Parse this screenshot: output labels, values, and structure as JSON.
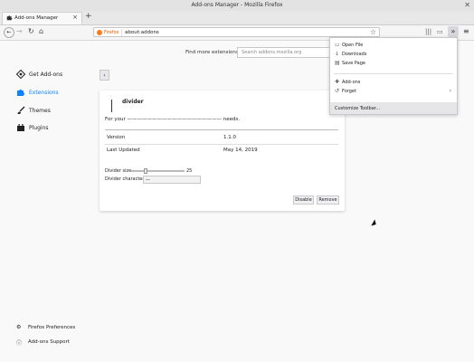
{
  "window": {
    "title": "Add-ons Manager - Mozilla Firefox"
  },
  "tab": {
    "label": "Add-ons Manager"
  },
  "urlbar": {
    "brand": "Firefox",
    "url": "about:addons"
  },
  "sidebar": {
    "items": [
      {
        "label": "Get Add-ons",
        "icon": "get-addons-icon"
      },
      {
        "label": "Extensions",
        "icon": "puzzle-icon"
      },
      {
        "label": "Themes",
        "icon": "brush-icon"
      },
      {
        "label": "Plugins",
        "icon": "plugin-icon"
      }
    ],
    "footer": [
      {
        "label": "Firefox Preferences",
        "icon": "gear-icon"
      },
      {
        "label": "Add-ons Support",
        "icon": "help-icon"
      }
    ]
  },
  "search": {
    "label": "Find more extensions",
    "placeholder": "Search addons.mozilla.org"
  },
  "addon": {
    "name": "divider",
    "description": "For your ——————————————————— needs.",
    "details": [
      {
        "key": "Version",
        "value": "1.1.0"
      },
      {
        "key": "Last Updated",
        "value": "May 14, 2019"
      }
    ],
    "prefs": {
      "size_label": "Divider size",
      "size_value": "25",
      "char_label": "Divider character",
      "char_value": "—"
    },
    "buttons": {
      "disable": "Disable",
      "remove": "Remove"
    }
  },
  "overflow_menu": {
    "items": [
      {
        "label": "Open File",
        "icon": "folder-icon"
      },
      {
        "label": "Downloads",
        "icon": "download-icon"
      },
      {
        "label": "Save Page",
        "icon": "save-icon"
      },
      {
        "label": "Add-ons",
        "icon": "puzzle-icon"
      },
      {
        "label": "Forget",
        "icon": "history-icon"
      }
    ],
    "customize": "Customize Toolbar..."
  },
  "colors": {
    "accent": "#0a84ff",
    "firefox_orange": "#ff7a1a"
  }
}
